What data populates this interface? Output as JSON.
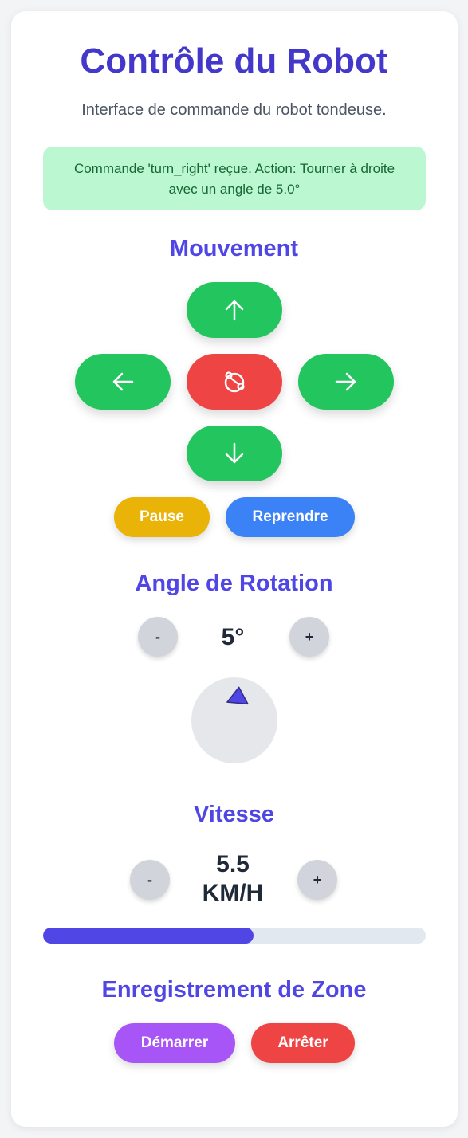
{
  "header": {
    "title": "Contrôle du Robot",
    "subtitle": "Interface de commande du robot tondeuse."
  },
  "status": {
    "message": "Commande 'turn_right' reçue. Action: Tourner à droite avec un angle de 5.0°"
  },
  "movement": {
    "title": "Mouvement",
    "buttons": {
      "up": "arrow-up-icon",
      "left": "arrow-left-icon",
      "stop": "robot-stop-icon",
      "right": "arrow-right-icon",
      "down": "arrow-down-icon"
    },
    "pause_label": "Pause",
    "resume_label": "Reprendre"
  },
  "rotation": {
    "title": "Angle de Rotation",
    "decrement_label": "-",
    "increment_label": "+",
    "value": "5°",
    "angle_degrees": 5
  },
  "speed": {
    "title": "Vitesse",
    "decrement_label": "-",
    "increment_label": "+",
    "value": "5.5",
    "unit": "KM/H",
    "level_fraction": 0.55
  },
  "zone": {
    "title": "Enregistrement de Zone",
    "start_label": "Démarrer",
    "stop_label": "Arrêter"
  },
  "colors": {
    "accent": "#4f46e5",
    "green": "#22c55e",
    "red": "#ef4444",
    "yellow": "#eab308",
    "blue": "#3b82f6",
    "purple": "#a855f7"
  }
}
